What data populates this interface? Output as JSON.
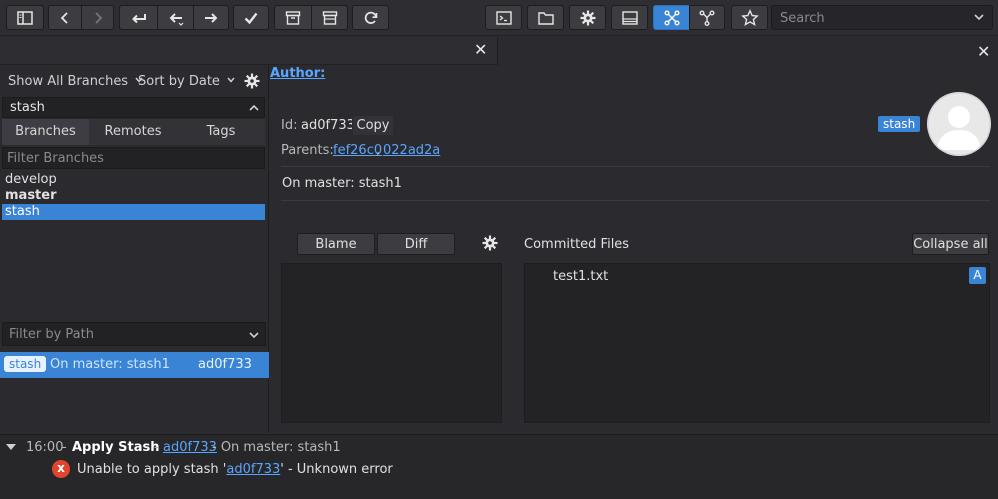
{
  "toolbar": {
    "search_placeholder": "Search"
  },
  "left": {
    "branch_filter_label": "Show All Branches",
    "sort_label": "Sort by Date",
    "filter_value": "stash",
    "tabs": [
      "Branches",
      "Remotes",
      "Tags"
    ],
    "filter_branches_placeholder": "Filter Branches",
    "branches": [
      {
        "name": "develop",
        "bold": false,
        "selected": false
      },
      {
        "name": "master",
        "bold": true,
        "selected": false
      },
      {
        "name": "stash",
        "bold": false,
        "selected": true
      }
    ],
    "filter_path_placeholder": "Filter by Path",
    "commit_row": {
      "badge": "stash",
      "message": "On master: stash1",
      "hash": "ad0f733"
    }
  },
  "detail": {
    "author_label": "Author:",
    "id_label": "Id:",
    "id_value": "ad0f733",
    "copy_label": "Copy",
    "parents_label": "Parents:",
    "parent1": "fef26c0",
    "parent_sep": ",",
    "parent2": "022ad2a",
    "ref_badge": "stash",
    "message": "On master: stash1",
    "blame_label": "Blame",
    "diff_label": "Diff",
    "committed_files_label": "Committed Files",
    "collapse_all_label": "Collapse all",
    "files": [
      {
        "name": "test1.txt",
        "status": "A"
      }
    ]
  },
  "log": {
    "time": "16:00",
    "time_sep": "-",
    "action": "Apply Stash",
    "dash1": "-",
    "hash": "ad0f733",
    "suffix": "- On master: stash1",
    "error_prefix": "Unable to apply stash '",
    "error_hash": "ad0f733",
    "error_suffix": "' - Unknown error",
    "error_icon": "x"
  },
  "colors": {
    "accent": "#3a84d6",
    "link": "#5aa6ff",
    "error": "#e0452d"
  }
}
